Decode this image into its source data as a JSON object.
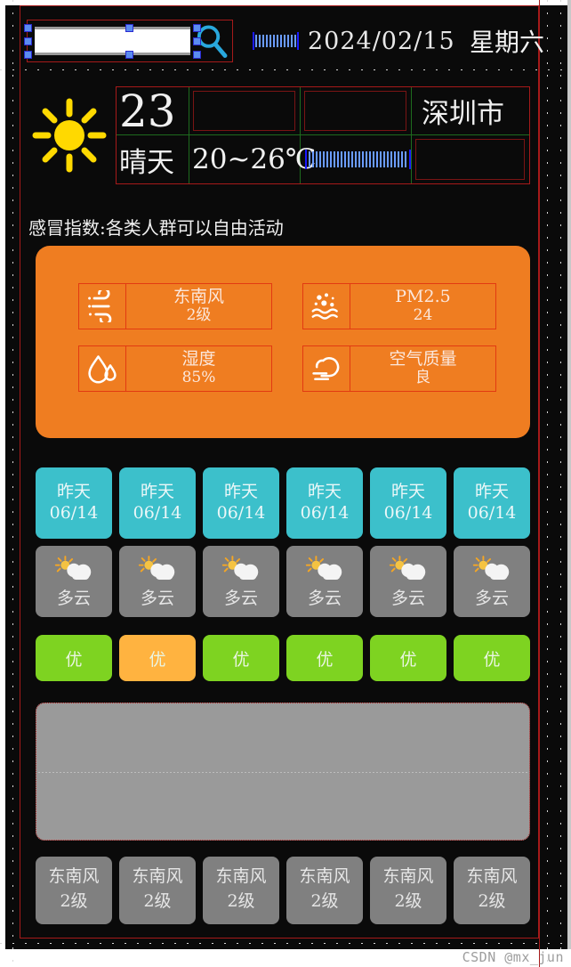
{
  "header": {
    "search_value": "",
    "search_placeholder": "",
    "search_icon": "search-icon",
    "date_deco_icon": "ruler-comb-icon",
    "date": "2024/02/15",
    "weekday": "星期六"
  },
  "current": {
    "weather_icon": "sun-icon",
    "temperature": "23",
    "condition": "晴天",
    "range": "20~26℃",
    "city": "深圳市",
    "comb_icon": "ruler-comb-icon",
    "cell_blank_1": "",
    "cell_blank_2": "",
    "cell_blank_3": ""
  },
  "tip": {
    "text": "感冒指数:各类人群可以自由活动"
  },
  "metrics": {
    "panel_color": "#ef7d21",
    "items": [
      {
        "icon": "wind-icon",
        "title": "东南风",
        "value": "2级"
      },
      {
        "icon": "pm25-icon",
        "title": "PM2.5",
        "value": "24"
      },
      {
        "icon": "humidity-icon",
        "title": "湿度",
        "value": "85%"
      },
      {
        "icon": "haze-icon",
        "title": "空气质量",
        "value": "良"
      }
    ]
  },
  "forecast": {
    "date_color": "#3cc0cb",
    "icon_color": "#808080",
    "wind_color": "#808080",
    "aqi_good_color": "#7ed321",
    "aqi_highlight_color": "#ffb340",
    "days": [
      {
        "day": "昨天",
        "date": "06/14",
        "icon": "sun-cloud-icon",
        "condition": "多云",
        "aqi": "优",
        "aqi_color": "#7ed321",
        "wind_dir": "东南风",
        "wind_level": "2级"
      },
      {
        "day": "昨天",
        "date": "06/14",
        "icon": "sun-cloud-icon",
        "condition": "多云",
        "aqi": "优",
        "aqi_color": "#ffb340",
        "wind_dir": "东南风",
        "wind_level": "2级"
      },
      {
        "day": "昨天",
        "date": "06/14",
        "icon": "sun-cloud-icon",
        "condition": "多云",
        "aqi": "优",
        "aqi_color": "#7ed321",
        "wind_dir": "东南风",
        "wind_level": "2级"
      },
      {
        "day": "昨天",
        "date": "06/14",
        "icon": "sun-cloud-icon",
        "condition": "多云",
        "aqi": "优",
        "aqi_color": "#7ed321",
        "wind_dir": "东南风",
        "wind_level": "2级"
      },
      {
        "day": "昨天",
        "date": "06/14",
        "icon": "sun-cloud-icon",
        "condition": "多云",
        "aqi": "优",
        "aqi_color": "#7ed321",
        "wind_dir": "东南风",
        "wind_level": "2级"
      },
      {
        "day": "昨天",
        "date": "06/14",
        "icon": "sun-cloud-icon",
        "condition": "多云",
        "aqi": "优",
        "aqi_color": "#7ed321",
        "wind_dir": "东南风",
        "wind_level": "2级"
      }
    ]
  },
  "chart": {
    "background": "#9a9a9a",
    "content": ""
  },
  "watermark": {
    "text": "CSDN @mx_jun"
  }
}
